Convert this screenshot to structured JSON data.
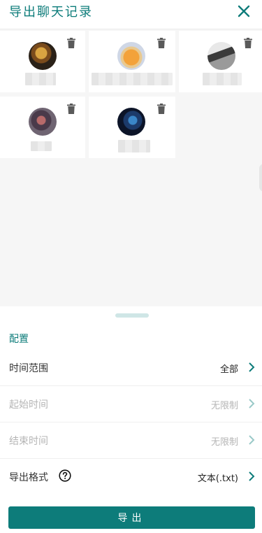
{
  "header": {
    "title": "导出聊天记录",
    "close_icon": "close-icon"
  },
  "colors": {
    "accent": "#0d7c7a",
    "disabled_text": "#b5b5b5"
  },
  "contacts": [
    {
      "avatar_icon": "avatar-image",
      "delete_icon": "trash-icon"
    },
    {
      "avatar_icon": "avatar-image",
      "delete_icon": "trash-icon"
    },
    {
      "avatar_icon": "avatar-image",
      "delete_icon": "trash-icon"
    },
    {
      "avatar_icon": "avatar-image",
      "delete_icon": "trash-icon"
    },
    {
      "avatar_icon": "avatar-image",
      "delete_icon": "trash-icon"
    }
  ],
  "config": {
    "section_title": "配置",
    "rows": [
      {
        "label": "时间范围",
        "value": "全部"
      },
      {
        "label": "起始时间",
        "value": "无限制"
      },
      {
        "label": "结束时间",
        "value": "无限制"
      },
      {
        "label": "导出格式",
        "value": "文本(.txt)"
      }
    ]
  },
  "export_button": {
    "label": "导出"
  }
}
